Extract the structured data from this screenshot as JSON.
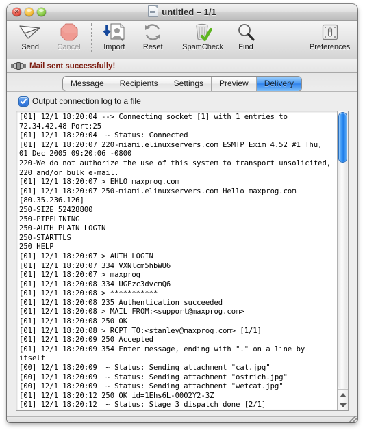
{
  "window": {
    "title": "untitled – 1/1",
    "doc_icon": "document-icon",
    "close_label": "",
    "minimize_label": "",
    "zoom_label": ""
  },
  "toolbar": {
    "items": [
      {
        "label": "Send",
        "icon": "paper-plane-icon",
        "disabled": false
      },
      {
        "label": "Cancel",
        "icon": "stop-octagon-icon",
        "disabled": true
      },
      {
        "label": "Import",
        "icon": "import-contact-icon",
        "disabled": false
      },
      {
        "label": "Reset",
        "icon": "refresh-arrows-icon",
        "disabled": false
      },
      {
        "label": "SpamCheck",
        "icon": "trash-check-icon",
        "disabled": false
      },
      {
        "label": "Find",
        "icon": "magnifier-icon",
        "disabled": false
      },
      {
        "label": "Preferences",
        "icon": "light-switch-icon",
        "disabled": false
      }
    ]
  },
  "status": {
    "icon": "connector-plug-icon",
    "message": "Mail sent successfully!",
    "color": "#7c1c10"
  },
  "tabs": {
    "items": [
      {
        "label": "Message",
        "active": false
      },
      {
        "label": "Recipients",
        "active": false
      },
      {
        "label": "Settings",
        "active": false
      },
      {
        "label": "Preview",
        "active": false
      },
      {
        "label": "Delivery",
        "active": true
      }
    ],
    "active_color": "#2f83ec"
  },
  "delivery": {
    "checkbox_label": "Output connection log to a file",
    "checkbox_checked": true
  },
  "log": {
    "lines": [
      "[01] 12/1 18:20:04 --> Connecting socket [1] with 1 entries to 72.34.42.48 Port:25",
      "[01] 12/1 18:20:04  ~ Status: Connected",
      "[01] 12/1 18:20:07 220-miami.elinuxservers.com ESMTP Exim 4.52 #1 Thu, 01 Dec 2005 09:20:06 -0800",
      "220-We do not authorize the use of this system to transport unsolicited,",
      "220 and/or bulk e-mail.",
      "[01] 12/1 18:20:07 > EHLO maxprog.com",
      "[01] 12/1 18:20:07 250-miami.elinuxservers.com Hello maxprog.com [80.35.236.126]",
      "250-SIZE 52428800",
      "250-PIPELINING",
      "250-AUTH PLAIN LOGIN",
      "250-STARTTLS",
      "250 HELP",
      "[01] 12/1 18:20:07 > AUTH LOGIN",
      "[01] 12/1 18:20:07 334 VXNlcm5hbWU6",
      "[01] 12/1 18:20:07 > maxprog",
      "[01] 12/1 18:20:08 334 UGFzc3dvcmQ6",
      "[01] 12/1 18:20:08 > ***********",
      "[01] 12/1 18:20:08 235 Authentication succeeded",
      "[01] 12/1 18:20:08 > MAIL FROM:<support@maxprog.com>",
      "[01] 12/1 18:20:08 250 OK",
      "[01] 12/1 18:20:08 > RCPT TO:<stanley@maxprog.com> [1/1]",
      "[01] 12/1 18:20:09 250 Accepted",
      "[01] 12/1 18:20:09 354 Enter message, ending with \".\" on a line by itself",
      "[00] 12/1 18:20:09  ~ Status: Sending attachment \"cat.jpg\"",
      "[00] 12/1 18:20:09  ~ Status: Sending attachment \"ostrich.jpg\"",
      "[00] 12/1 18:20:09  ~ Status: Sending attachment \"wetcat.jpg\"",
      "[01] 12/1 18:20:12 250 OK id=1Ehs6L-0002Y2-3Z",
      "[01] 12/1 18:20:12  ~ Status: Stage 3 dispatch done [2/1]"
    ]
  },
  "scrollbar": {
    "up_arrow": "scroll-up-arrow-icon",
    "down_arrow": "scroll-down-arrow-icon"
  }
}
